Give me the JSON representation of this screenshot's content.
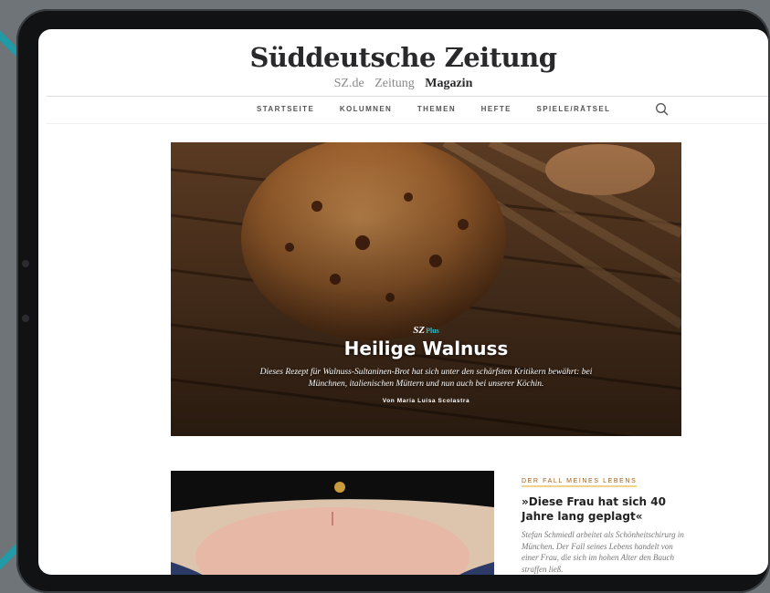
{
  "site": {
    "logo": "Süddeutsche Zeitung",
    "sections": [
      "SZ.de",
      "Zeitung",
      "Magazin"
    ],
    "active_section": "Magazin"
  },
  "nav": {
    "items": [
      "STARTSEITE",
      "KOLUMNEN",
      "THEMEN",
      "HEFTE",
      "SPIELE/RÄTSEL"
    ],
    "search_icon": "search-icon"
  },
  "hero": {
    "badge_sz": "SZ",
    "badge_plus": "Plus",
    "title": "Heilige Walnuss",
    "description": "Dieses Rezept für Walnuss-Sultaninen-Brot hat sich unter den schärfsten Kritikern bewährt: bei Münchnen, italienischen Müttern und nun auch bei unserer Köchin.",
    "author": "Von Maria Luisa Scolastra"
  },
  "article2": {
    "kicker": "DER FALL MEINES LEBENS",
    "title": "»Diese Frau hat sich 40 Jahre lang geplagt«",
    "description": "Stefan Schmiedl arbeitet als Schönheitschirurg in München. Der Fall seines Lebens handelt von einer Frau, die sich im hohen Alter den Bauch straffen ließ."
  },
  "colors": {
    "accent_plus": "#36b6c0",
    "kicker": "#a15c12",
    "kicker_underline": "#f0d28a",
    "device_frame": "#111214"
  }
}
